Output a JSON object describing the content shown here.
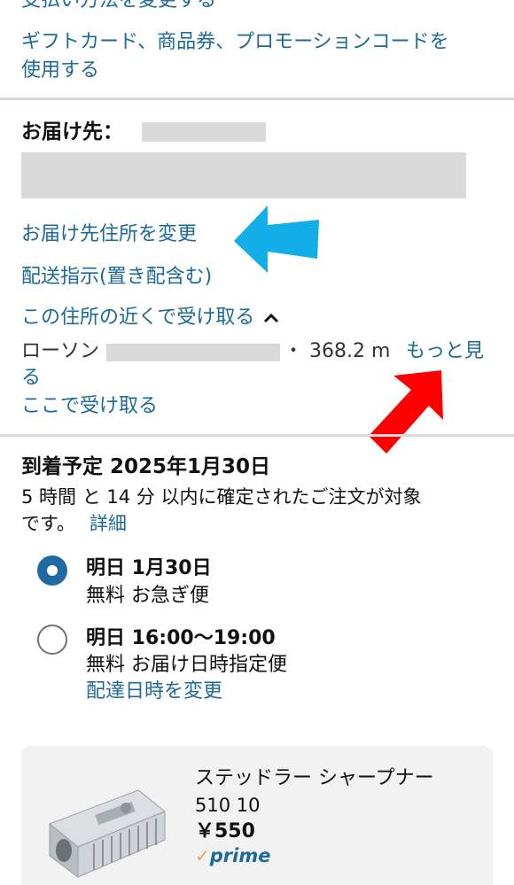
{
  "payment": {
    "change_method": "支払い方法を変更する",
    "gift_card_line1": "ギフトカード、商品券、プロモーションコードを",
    "gift_card_line2": "使用する"
  },
  "delivery": {
    "heading": "お届け先：",
    "change_address": "お届け先住所を変更",
    "instructions": "配送指示(置き配含む)",
    "pickup_nearby": "この住所の近くで受け取る",
    "pickup_store_prefix": "ローソン",
    "pickup_distance": "・ 368.2 m",
    "see_more": "もっと見",
    "see_more_cont": "る",
    "pickup_here": "ここで受け取る"
  },
  "arrival": {
    "heading": "到着予定  2025年1月30日",
    "notice_line1": "5 時間 と 14 分 以内に確定されたご注文が対象",
    "notice_line2": "です。",
    "details_link": "詳細",
    "options": [
      {
        "title": "明日  1月30日",
        "subtitle": "無料  お急ぎ便",
        "selected": true
      },
      {
        "title": "明日  16:00〜19:00",
        "subtitle": "無料  お届け日時指定便",
        "selected": false
      }
    ],
    "change_datetime": "配達日時を変更"
  },
  "product": {
    "name": "ステッドラー シャープナー",
    "model": "510 10",
    "price": "￥550",
    "prime_check": "✓",
    "prime_label": "prime"
  },
  "colors": {
    "link": "#1c6a99",
    "radio_selected": "#1f6aa3",
    "prime": "#f3a847",
    "arrow_blue": "#12aee8",
    "arrow_red": "#ff0000"
  }
}
